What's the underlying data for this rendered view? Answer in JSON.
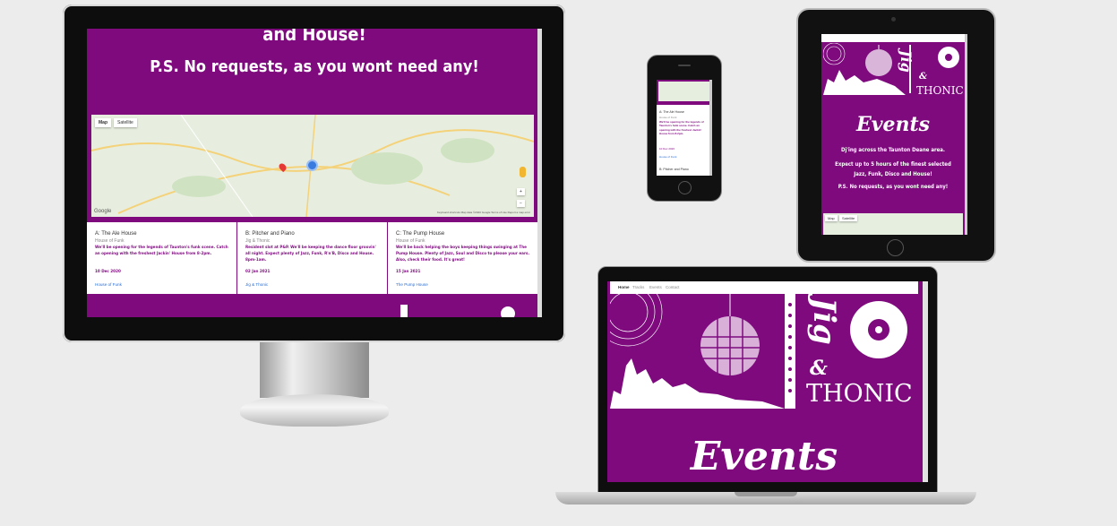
{
  "monitor": {
    "hero_line1": "and House!",
    "hero_line2": "P.S. No requests, as you wont need any!",
    "map_tabs": [
      "Map",
      "Satellite"
    ],
    "map_logo": "Google",
    "map_credit": "Keyboard shortcuts  Map data ©2020 Google  Terms of Use  Report a map error",
    "cards": [
      {
        "title": "A: The Ale House",
        "sub": "House of Funk",
        "desc": "We'll be opening for the legends of Taunton's funk scene. Catch an opening with the freshest Jackin' House from 8-2pm.",
        "date": "10 Dec 2020",
        "link": "House of Funk"
      },
      {
        "title": "B: Pitcher and Piano",
        "sub": "Jig & Thonic",
        "desc": "Resident slot at P&P. We'll be keeping the dance floor groovin' all night. Expect plenty of Jazz, Funk, R'n'B, Disco and House. 8pm-1am.",
        "date": "02 Jan 2021",
        "link": "Jig & Thonic"
      },
      {
        "title": "C: The Pump House",
        "sub": "House of Funk",
        "desc": "We'll be back helping the boys keeping things swinging at The Pump House. Plenty of Jazz, Soul and Disco to please your ears. Also, check their food. It's great!",
        "date": "15 Jan 2021",
        "link": "The Pump House"
      }
    ]
  },
  "phone": {
    "title": "A: The Ale House",
    "sub": "House of Funk",
    "desc": "We'll be opening for the legends of Taunton's funk scene. Catch an opening with the freshest Jackin' House from 8-2pm.",
    "date": "10 Dec 2020",
    "link": "House of Funk",
    "next": "B: Pitcher and Piano"
  },
  "tablet": {
    "brand_top": "Jig",
    "brand_amp": "&",
    "brand_bottom": "THONIC",
    "heading": "Events",
    "line1": "Dj'ing across the Taunton Deane area.",
    "line2": "Expect up to 5 hours of the finest selected Jazz, Funk, Disco and House!",
    "line3": "P.S. No requests, as you wont need any!",
    "map_tabs": [
      "Map",
      "Satellite"
    ]
  },
  "laptop": {
    "nav": [
      "Home",
      "Tracks",
      "Events",
      "Contact"
    ],
    "brand_top": "Jig",
    "brand_amp": "&",
    "brand_bottom": "THONIC",
    "heading": "Events"
  },
  "colors": {
    "brand_purple": "#7e0a7e",
    "background": "#ececec",
    "link_blue": "#2a6fd6"
  }
}
